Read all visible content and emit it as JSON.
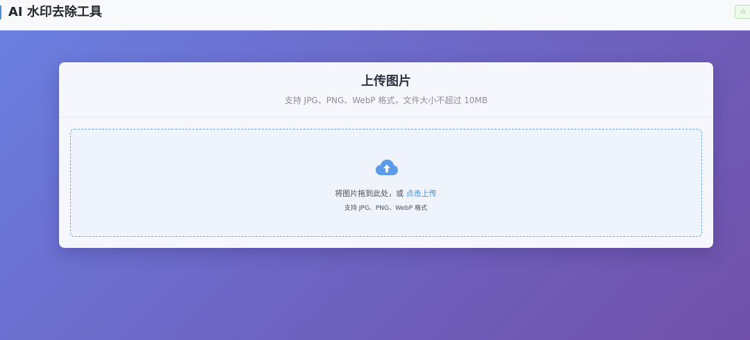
{
  "header": {
    "title": "AI 水印去除工具",
    "star_icon": "star-icon",
    "star_glyph": "☆"
  },
  "upload_card": {
    "title": "上传图片",
    "subtitle": "支持 JPG、PNG、WebP 格式，文件大小不超过 10MB",
    "dropzone": {
      "icon": "cloud-upload-icon",
      "drag_text": "将图片拖到此处，或 ",
      "click_text": "点击上传",
      "hint": "支持 JPG、PNG、WebP 格式"
    }
  },
  "colors": {
    "accent": "#4a90e2",
    "link": "#3b8be0",
    "gradient_start": "#6a7fe0",
    "gradient_end": "#7050a8"
  }
}
